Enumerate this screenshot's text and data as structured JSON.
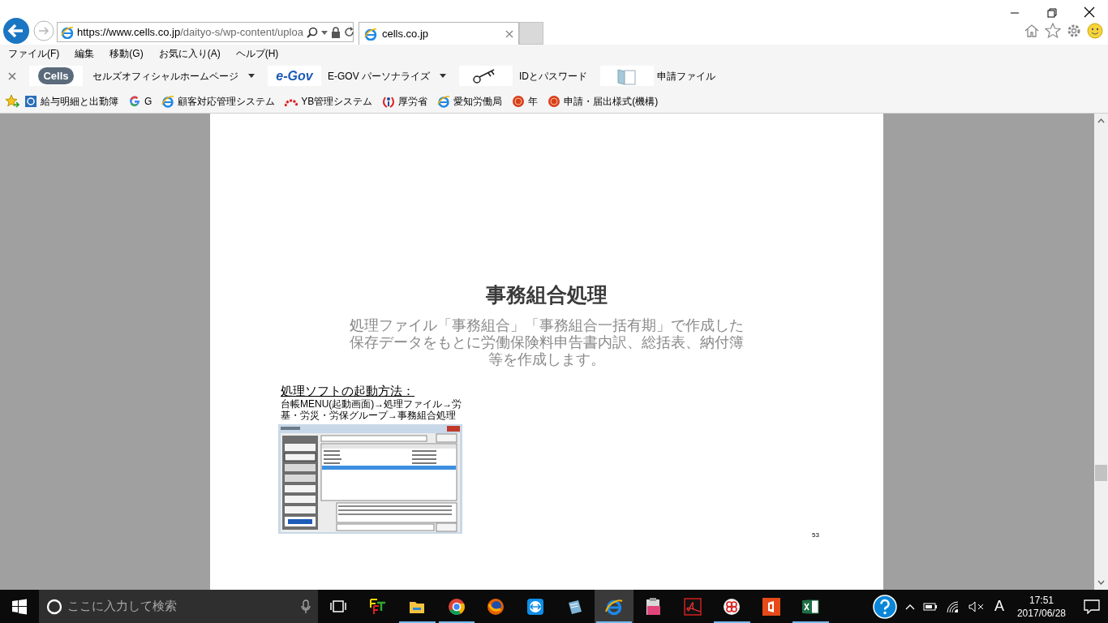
{
  "address_bar": {
    "url_host": "https://www.cells.co.jp",
    "url_path": "/daityo-s/wp-content/uploa"
  },
  "tabs": [
    {
      "label": "cells.co.jp",
      "selected": true
    }
  ],
  "menu": [
    "ファイル(F)",
    "編集",
    "移動(G)",
    "お気に入り(A)",
    "ヘルプ(H)"
  ],
  "links_bar": [
    {
      "kind": "cells",
      "logo_text": "Cells",
      "label": "セルズオフィシャルホームページ",
      "dropdown": true
    },
    {
      "kind": "egov",
      "logo_text": "e-Gov",
      "label": "E-GOV パーソナライズ",
      "dropdown": true
    },
    {
      "kind": "key",
      "label": "IDとパスワード",
      "dropdown": false
    },
    {
      "kind": "folder",
      "label": "申請ファイル",
      "dropdown": false
    }
  ],
  "favorites": [
    {
      "kind": "app",
      "label": "給与明細と出勤簿"
    },
    {
      "kind": "google",
      "label": "G"
    },
    {
      "kind": "ie",
      "label": "顧客対応管理システム"
    },
    {
      "kind": "arcs",
      "label": "YB管理システム"
    },
    {
      "kind": "figure",
      "label": "厚労省"
    },
    {
      "kind": "ie",
      "label": "愛知労働局"
    },
    {
      "kind": "seal",
      "label": "年"
    },
    {
      "kind": "seal",
      "label": "申請・届出様式(機構)"
    }
  ],
  "document": {
    "title": "事務組合処理",
    "description_lines": [
      "処理ファイル「事務組合」「事務組合一括有期」で作成した",
      "保存データをもとに労働保険料申告書内訳、総括表、納付簿",
      "等を作成します。"
    ],
    "launch_heading": "処理ソフトの起動方法：",
    "launch_lines": [
      "台帳MENU(起動画面)→処理ファイル→労",
      "基・労災・労保グループ→事務組合処理"
    ],
    "page_number": "53"
  },
  "taskbar": {
    "search_placeholder": "ここに入力して検索",
    "apps": [
      {
        "kind": "taskview",
        "running": false,
        "active": false
      },
      {
        "kind": "ftp",
        "running": false,
        "active": false
      },
      {
        "kind": "explorer",
        "running": true,
        "active": false
      },
      {
        "kind": "chrome",
        "running": true,
        "active": false
      },
      {
        "kind": "firefox",
        "running": false,
        "active": false
      },
      {
        "kind": "teamviewer",
        "running": false,
        "active": false
      },
      {
        "kind": "notepad",
        "running": false,
        "active": false
      },
      {
        "kind": "ie",
        "running": true,
        "active": true
      },
      {
        "kind": "dw",
        "running": false,
        "active": false
      },
      {
        "kind": "acrobat",
        "running": false,
        "active": false
      },
      {
        "kind": "ring",
        "running": true,
        "active": false
      },
      {
        "kind": "office",
        "running": false,
        "active": false
      },
      {
        "kind": "excel",
        "running": true,
        "active": false
      }
    ],
    "ime": "A",
    "time": "17:51",
    "date": "2017/06/28"
  }
}
